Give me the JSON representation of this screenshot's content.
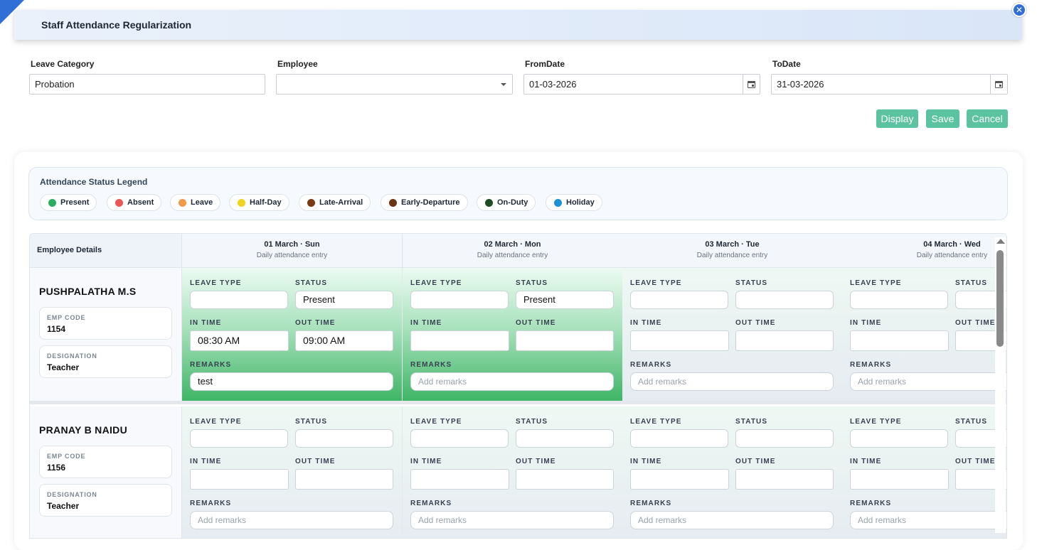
{
  "header": {
    "title": "Staff Attendance Regularization"
  },
  "filters": {
    "leave_category": {
      "label": "Leave Category",
      "value": "Probation"
    },
    "employee": {
      "label": "Employee",
      "value": ""
    },
    "from_date": {
      "label": "FromDate",
      "value": "01-03-2026"
    },
    "to_date": {
      "label": "ToDate",
      "value": "31-03-2026"
    }
  },
  "actions": {
    "display": "Display",
    "save": "Save",
    "cancel": "Cancel"
  },
  "legend": {
    "title": "Attendance Status Legend",
    "items": [
      {
        "label": "Present",
        "color": "#27ae60"
      },
      {
        "label": "Absent",
        "color": "#eb5757"
      },
      {
        "label": "Leave",
        "color": "#f2994a"
      },
      {
        "label": "Half-Day",
        "color": "#f2d21b"
      },
      {
        "label": "Late-Arrival",
        "color": "#7a3a12"
      },
      {
        "label": "Early-Departure",
        "color": "#6b3410"
      },
      {
        "label": "On-Duty",
        "color": "#1e4d24"
      },
      {
        "label": "Holiday",
        "color": "#1e90d6"
      }
    ]
  },
  "grid": {
    "employee_header": "Employee Details",
    "day_subtitle": "Daily attendance entry",
    "field_labels": {
      "leave_type": "LEAVE TYPE",
      "status": "STATUS",
      "in_time": "IN TIME",
      "out_time": "OUT TIME",
      "remarks": "REMARKS"
    },
    "remarks_placeholder": "Add remarks",
    "days": [
      {
        "title": "01 March · Sun"
      },
      {
        "title": "02 March · Mon"
      },
      {
        "title": "03 March · Tue"
      },
      {
        "title": "04 March · Wed"
      }
    ],
    "employees": [
      {
        "name": "PUSHPALATHA M.S",
        "emp_code_label": "EMP CODE",
        "emp_code": "1154",
        "designation_label": "DESIGNATION",
        "designation": "Teacher",
        "entries": [
          {
            "leave_type": "",
            "status": "Present",
            "in_time": "08:30 AM",
            "out_time": "09:00 AM",
            "remarks": "test"
          },
          {
            "leave_type": "",
            "status": "Present",
            "in_time": "",
            "out_time": "",
            "remarks": ""
          },
          {
            "leave_type": "",
            "status": "",
            "in_time": "",
            "out_time": "",
            "remarks": ""
          },
          {
            "leave_type": "",
            "status": "",
            "in_time": "",
            "out_time": "",
            "remarks": ""
          }
        ]
      },
      {
        "name": "PRANAY B NAIDU",
        "emp_code_label": "EMP CODE",
        "emp_code": "1156",
        "designation_label": "DESIGNATION",
        "designation": "Teacher",
        "entries": [
          {
            "leave_type": "",
            "status": "",
            "in_time": "",
            "out_time": "",
            "remarks": ""
          },
          {
            "leave_type": "",
            "status": "",
            "in_time": "",
            "out_time": "",
            "remarks": ""
          },
          {
            "leave_type": "",
            "status": "",
            "in_time": "",
            "out_time": "",
            "remarks": ""
          },
          {
            "leave_type": "",
            "status": "",
            "in_time": "",
            "out_time": "",
            "remarks": ""
          }
        ]
      }
    ]
  }
}
